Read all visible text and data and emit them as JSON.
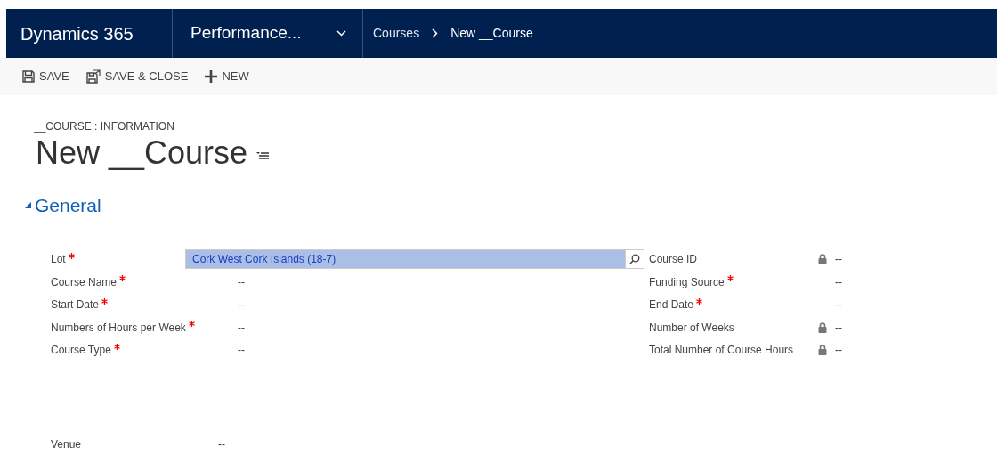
{
  "nav": {
    "app": "Dynamics 365",
    "area": "Performance...",
    "breadcrumbs": [
      "Courses",
      "New __Course"
    ]
  },
  "toolbar": [
    {
      "kind": "save",
      "label": "SAVE"
    },
    {
      "kind": "save-close",
      "label": "SAVE & CLOSE"
    },
    {
      "kind": "new",
      "label": "NEW"
    }
  ],
  "form": {
    "entity": "__COURSE : INFORMATION",
    "title": "New __Course"
  },
  "section": {
    "title": "General",
    "expanded": true
  },
  "left_fields": [
    {
      "label": "Lot",
      "required": true,
      "kind": "lookup",
      "value": "Cork West Cork Islands (18-7)",
      "selected": true
    },
    {
      "label": "Course Name",
      "required": true,
      "kind": "text",
      "value": "--"
    },
    {
      "label": "Start Date",
      "required": true,
      "kind": "text",
      "value": "--"
    },
    {
      "label": "Numbers of Hours per Week",
      "required": true,
      "kind": "text",
      "value": "--"
    },
    {
      "label": "Course Type",
      "required": true,
      "kind": "text",
      "value": "--"
    }
  ],
  "right_fields": [
    {
      "label": "Course ID",
      "required": false,
      "locked": true,
      "value": "--"
    },
    {
      "label": "Funding Source",
      "required": true,
      "locked": false,
      "value": "--"
    },
    {
      "label": "End Date",
      "required": true,
      "locked": false,
      "value": "--"
    },
    {
      "label": "Number of Weeks",
      "required": false,
      "locked": true,
      "value": "--"
    },
    {
      "label": "Total Number of Course Hours",
      "required": false,
      "locked": true,
      "value": "--"
    }
  ],
  "bottom_fields": [
    {
      "label": "Venue",
      "value": "--"
    }
  ]
}
